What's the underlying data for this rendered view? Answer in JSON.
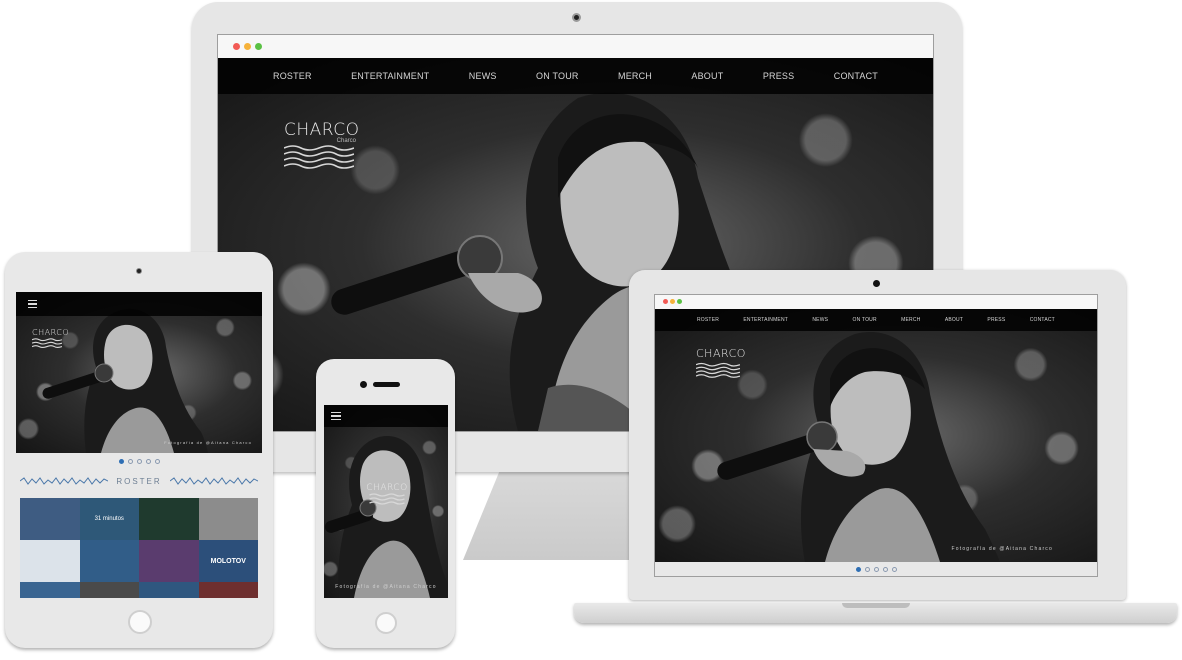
{
  "site": {
    "logo": "CHARCO",
    "logo_sub": "Charco",
    "nav": [
      "ROSTER",
      "ENTERTAINMENT",
      "NEWS",
      "ON TOUR",
      "MERCH",
      "ABOUT",
      "PRESS",
      "CONTACT"
    ],
    "caption": "Fotografía de @Aitana Charco",
    "roster_title": "ROSTER",
    "roster_tiles": [
      "",
      "31 minutos",
      "",
      "",
      "",
      "",
      "",
      "MOLOTOV"
    ]
  },
  "slider": {
    "count": 5,
    "active": 1
  },
  "colors": {
    "accent": "#2f6fb4",
    "device": "#e4e4e4",
    "device_edge": "#cfcfcf"
  }
}
